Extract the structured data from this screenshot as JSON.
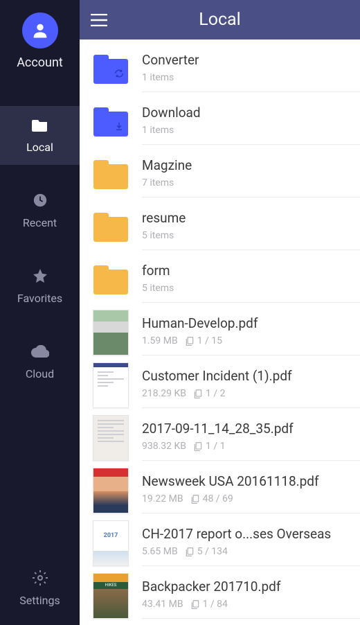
{
  "sidebar": {
    "account_label": "Account",
    "items": [
      {
        "label": "Local"
      },
      {
        "label": "Recent"
      },
      {
        "label": "Favorites"
      },
      {
        "label": "Cloud"
      }
    ],
    "settings_label": "Settings"
  },
  "header": {
    "title": "Local"
  },
  "files": [
    {
      "type": "folder",
      "color": "blue",
      "badge": "sync",
      "name": "Converter",
      "meta": "1 items"
    },
    {
      "type": "folder",
      "color": "blue",
      "badge": "download",
      "name": "Download",
      "meta": "1 items"
    },
    {
      "type": "folder",
      "color": "yellow",
      "name": "Magzine",
      "meta": "7 items"
    },
    {
      "type": "folder",
      "color": "yellow",
      "name": "resume",
      "meta": "5 items"
    },
    {
      "type": "folder",
      "color": "yellow",
      "name": "form",
      "meta": "5 items"
    },
    {
      "type": "pdf",
      "thumb_style": "photo",
      "name": "Human-Develop.pdf",
      "size": "1.59 MB",
      "pages": "1 / 15"
    },
    {
      "type": "pdf",
      "thumb_style": "doc",
      "name": "Customer Incident (1).pdf",
      "size": "218.29 KB",
      "pages": "1 / 2"
    },
    {
      "type": "pdf",
      "thumb_style": "form",
      "name": "2017-09-11_14_28_35.pdf",
      "size": "938.32 KB",
      "pages": "1 / 1"
    },
    {
      "type": "pdf",
      "thumb_style": "newsweek",
      "name": "Newsweek USA 20161118.pdf",
      "size": "19.22 MB",
      "pages": "48 / 69"
    },
    {
      "type": "pdf",
      "thumb_style": "report",
      "name": "CH-2017 report o...ses Overseas",
      "size": "5.65 MB",
      "pages": "5 / 134"
    },
    {
      "type": "pdf",
      "thumb_style": "backpacker",
      "name": "Backpacker 201710.pdf",
      "size": "43.41 MB",
      "pages": "1 / 84"
    }
  ]
}
